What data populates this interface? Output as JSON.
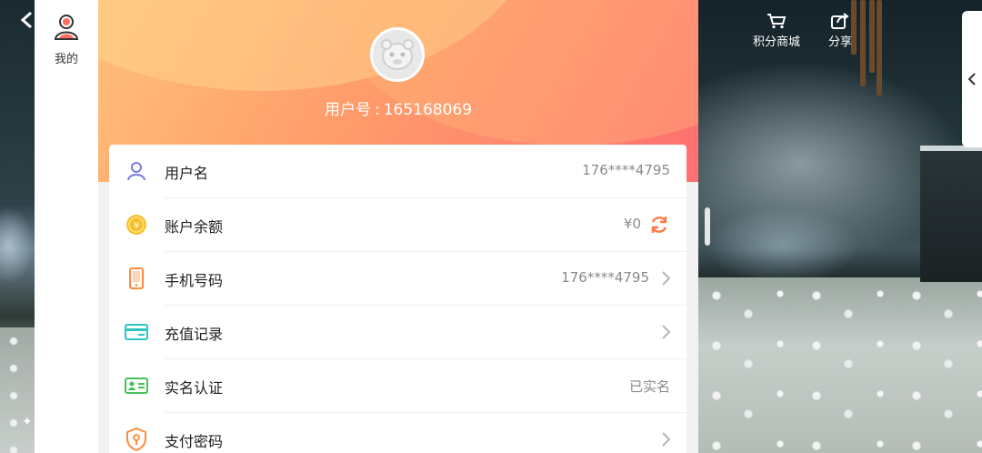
{
  "sidebar": {
    "back_icon": "chevron-left-icon",
    "profile_icon": "user-profile-icon",
    "tab_label": "我的"
  },
  "header": {
    "user_id_label": "用户号",
    "user_id_sep": ":",
    "user_id_value": "165168069"
  },
  "rows": [
    {
      "label": "用户名",
      "value": "176****4795",
      "icon": "user-icon"
    },
    {
      "label": "账户余额",
      "value": "¥0",
      "icon": "coin-icon",
      "action_icon": "refresh-icon"
    },
    {
      "label": "手机号码",
      "value": "176****4795",
      "icon": "phone-icon",
      "action_icon": "chevron-right-icon"
    },
    {
      "label": "充值记录",
      "value": "",
      "icon": "card-icon",
      "action_icon": "chevron-right-icon"
    },
    {
      "label": "实名认证",
      "value": "已实名",
      "icon": "id-card-icon"
    },
    {
      "label": "支付密码",
      "value": "",
      "icon": "shield-lock-icon",
      "action_icon": "chevron-right-icon"
    }
  ],
  "top_actions": {
    "points_mall": "积分商城",
    "share": "分享"
  },
  "colors": {
    "header_start": "#ffc07a",
    "header_end": "#ff6f72",
    "refresh_accent": "#ff7a45",
    "user_icon": "#7a7ae6",
    "coin_icon": "#f7c02b",
    "phone_icon": "#ff8a3c",
    "card_icon": "#2bc7c0",
    "id_icon": "#45c35a",
    "shield_icon": "#ff8a3c"
  }
}
